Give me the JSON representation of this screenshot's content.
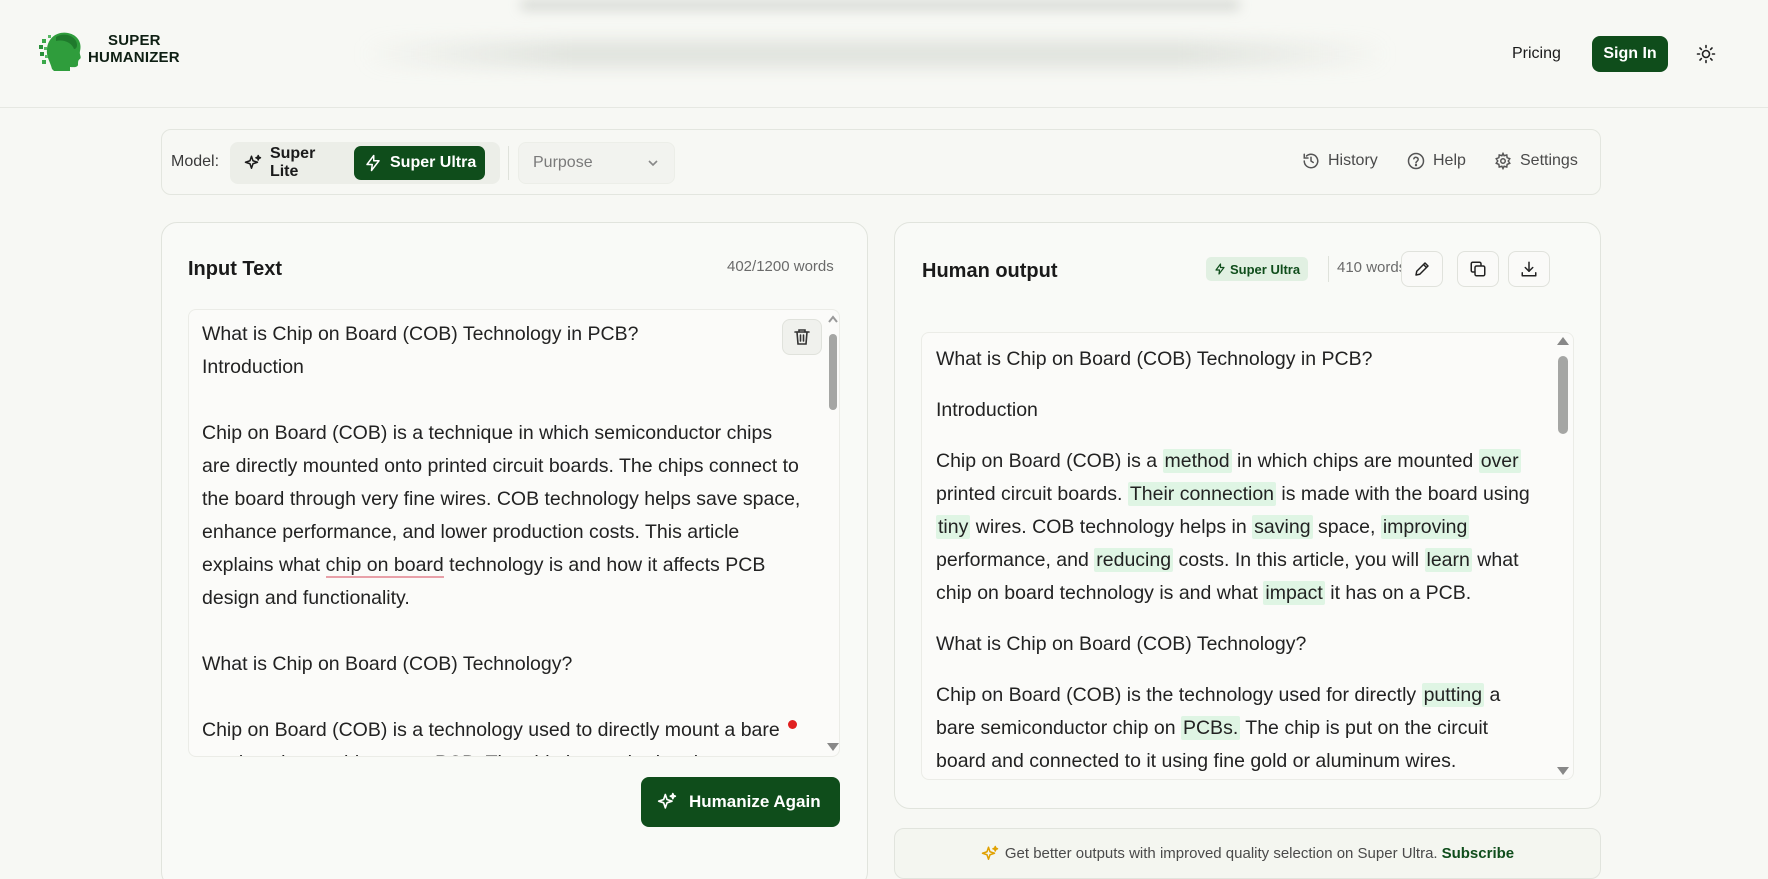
{
  "header": {
    "logo_line1": "SUPER",
    "logo_line2": "HUMANIZER",
    "pricing": "Pricing",
    "sign_in": "Sign In"
  },
  "toolbar": {
    "model_label": "Model:",
    "model_options": [
      "Super Lite",
      "Super Ultra"
    ],
    "selected_model": "Super Ultra",
    "purpose_placeholder": "Purpose",
    "history": "History",
    "help": "Help",
    "settings": "Settings"
  },
  "input_panel": {
    "title": "Input Text",
    "word_count": "402/1200 words",
    "text": "What is Chip on Board (COB) Technology in PCB?\nIntroduction\n\nChip on Board (COB) is a technique in which semiconductor chips are directly mounted onto printed circuit boards. The chips connect to the board through very fine wires. COB technology helps save space, enhance performance, and lower production costs. This article explains what chip on board technology is and how it affects PCB design and functionality.\n\nWhat is Chip on Board (COB) Technology?\n\nChip on Board (COB) is a technology used to directly mount a bare semiconductor chip onto a PCB. The chip is attached and",
    "humanize_button": "Humanize Again"
  },
  "output_panel": {
    "title": "Human output",
    "model_badge": "Super Ultra",
    "word_count": "410 words",
    "p1": "What is Chip on Board (COB) Technology in PCB?",
    "p2": "Introduction",
    "p3": [
      {
        "t": "Chip on Board (COB) is a ",
        "h": false
      },
      {
        "t": "method",
        "h": true
      },
      {
        "t": " in which chips are mounted ",
        "h": false
      },
      {
        "t": "over",
        "h": true
      },
      {
        "t": " printed circuit boards.  ",
        "h": false
      },
      {
        "t": "Their connection",
        "h": true
      },
      {
        "t": " is made with the board using ",
        "h": false
      },
      {
        "t": "tiny",
        "h": true
      },
      {
        "t": " wires.  COB technology helps in ",
        "h": false
      },
      {
        "t": "saving",
        "h": true
      },
      {
        "t": " space, ",
        "h": false
      },
      {
        "t": "improving",
        "h": true
      },
      {
        "t": " performance, and ",
        "h": false
      },
      {
        "t": "reducing",
        "h": true
      },
      {
        "t": " costs.  In this article, you will ",
        "h": false
      },
      {
        "t": "learn",
        "h": true
      },
      {
        "t": " what chip on board technology is and what ",
        "h": false
      },
      {
        "t": "impact",
        "h": true
      },
      {
        "t": " it has on a PCB.",
        "h": false
      }
    ],
    "p4": "What is Chip on Board (COB) Technology?",
    "p5": [
      {
        "t": "Chip on Board (COB) is the technology used for directly ",
        "h": false
      },
      {
        "t": "putting",
        "h": true
      },
      {
        "t": " a bare semiconductor chip on ",
        "h": false
      },
      {
        "t": "PCBs.",
        "h": true
      },
      {
        "t": "  The chip is put on the circuit board and connected to it using fine gold or aluminum wires.",
        "h": false
      }
    ]
  },
  "promo": {
    "text": "Get better outputs with improved quality selection on Super Ultra.",
    "link": "Subscribe"
  }
}
